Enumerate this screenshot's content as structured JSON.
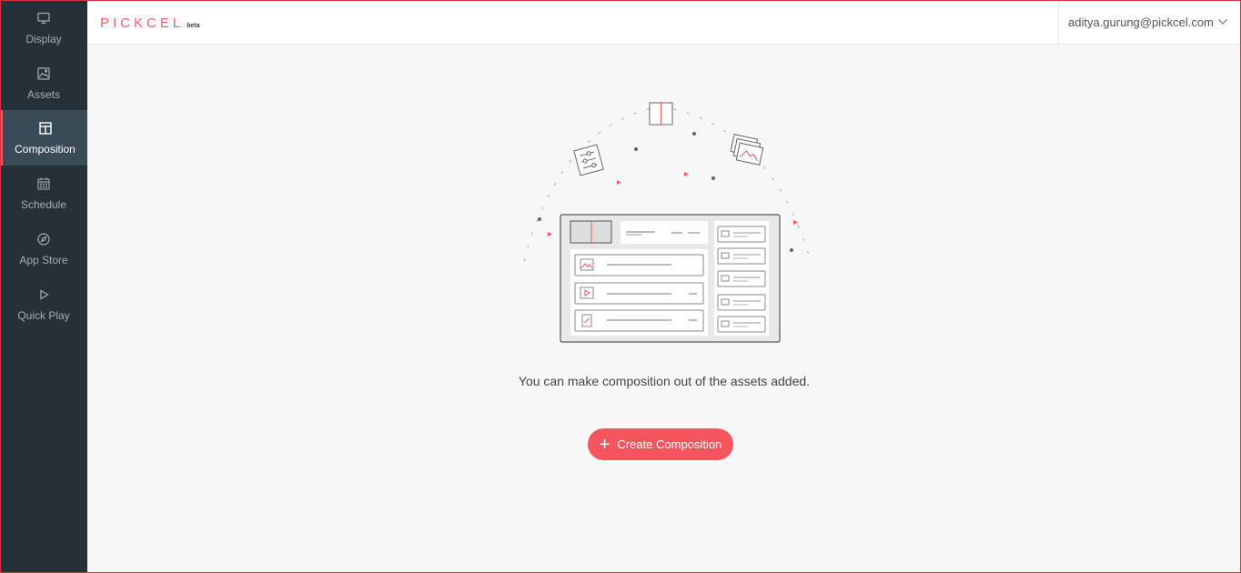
{
  "brand": {
    "name": "PICKCEL",
    "badge": "beta",
    "accent": "#f5565d"
  },
  "sidebar": {
    "items": [
      {
        "label": "Display",
        "icon": "monitor-icon",
        "active": false
      },
      {
        "label": "Assets",
        "icon": "image-icon",
        "active": false
      },
      {
        "label": "Composition",
        "icon": "layout-icon",
        "active": true
      },
      {
        "label": "Schedule",
        "icon": "calendar-icon",
        "active": false
      },
      {
        "label": "App Store",
        "icon": "compass-icon",
        "active": false
      },
      {
        "label": "Quick Play",
        "icon": "play-icon",
        "active": false
      }
    ]
  },
  "header": {
    "user_email": "aditya.gurung@pickcel.com"
  },
  "main": {
    "empty_message": "You can make composition out of the assets added.",
    "create_button_label": "Create Composition"
  }
}
